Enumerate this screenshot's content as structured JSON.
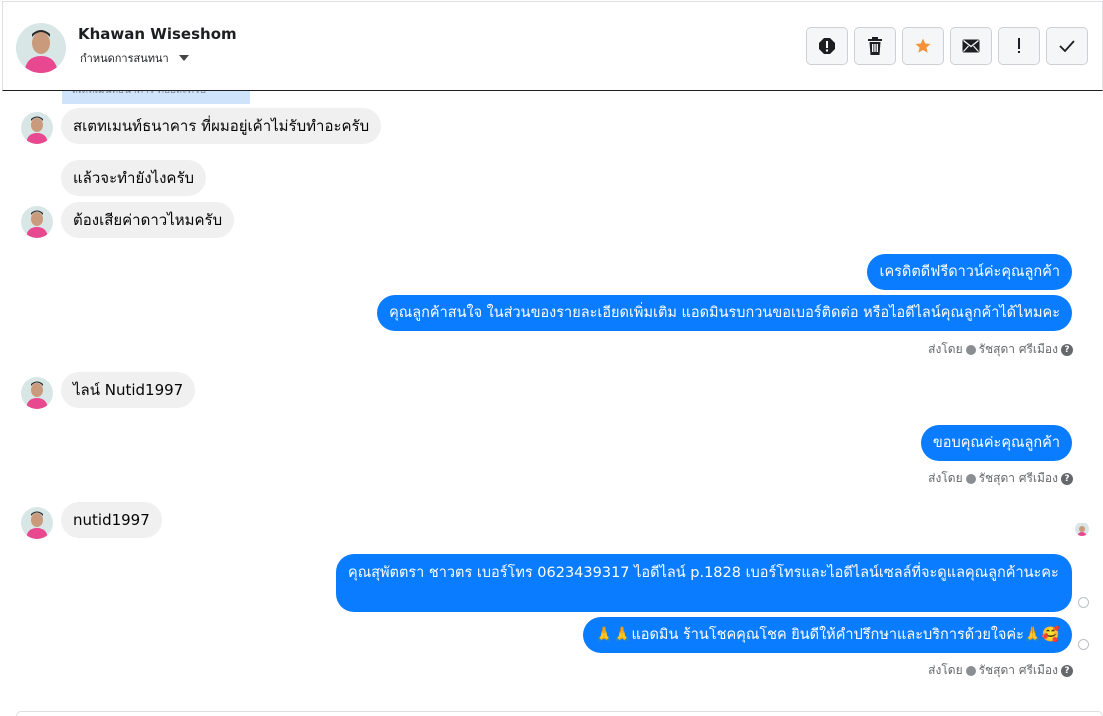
{
  "header": {
    "contact_name": "Khawan Wiseshom",
    "assign_label": "กำหนดการสนทนา",
    "actions": [
      {
        "icon": "alert-octagon-icon",
        "name": "spam-button"
      },
      {
        "icon": "trash-icon",
        "name": "delete-button"
      },
      {
        "icon": "star-icon",
        "name": "star-button"
      },
      {
        "icon": "envelope-icon",
        "name": "mark-unread-button"
      },
      {
        "icon": "exclamation-icon",
        "name": "follow-up-button"
      },
      {
        "icon": "check-icon",
        "name": "done-button"
      }
    ]
  },
  "thread": {
    "clipped_text": "สเตทเมนท์ธนาคาร ค้อยละครับ",
    "messages": [
      {
        "dir": "in",
        "text": "สเตทเมนท์ธนาคาร ที่ผมอยู่เค้าไม่รับทำอะครับ"
      },
      {
        "dir": "in",
        "text": "แล้วจะทำยังไงครับ"
      },
      {
        "dir": "in",
        "text": "ต้องเสียค่าดาวไหมครับ"
      },
      {
        "dir": "out",
        "text": "เครดิตดีฟรีดาวน์ค่ะคุณลูกค้า"
      },
      {
        "dir": "out",
        "text": "คุณลูกค้าสนใจ ในส่วนของรายละเอียดเพิ่มเติม แอดมินรบกวนขอเบอร์ติดต่อ หรือไอดีไลน์คุณลูกค้าได้ไหมคะ"
      },
      {
        "dir": "in",
        "text": "ไลน์ Nutid1997"
      },
      {
        "dir": "out",
        "text": "ขอบคุณค่ะคุณลูกค้า"
      },
      {
        "dir": "in",
        "text": "nutid1997"
      },
      {
        "dir": "out",
        "text": "คุณสุพัตตรา   ชาวตร      เบอร์โทร 0623439317  ไอดีไลน์ p.1828   เบอร์โทรและไอดีไลน์เซลล์ที่จะดูแลคุณลูกค้านะคะ"
      },
      {
        "dir": "out",
        "text": "🙏🙏แอดมิน ร้านโชคคุณโชค ยินดีให้คำปรึกษาและบริการด้วยใจค่ะ🙏🥰"
      }
    ],
    "sent_by": {
      "prefix": "ส่งโดย",
      "name": "รัชสุดา ศรีเมือง",
      "help": "?"
    }
  },
  "colors": {
    "outgoing": "#0a7cff",
    "incoming": "#f0f0f0",
    "star": "#f7923a"
  }
}
